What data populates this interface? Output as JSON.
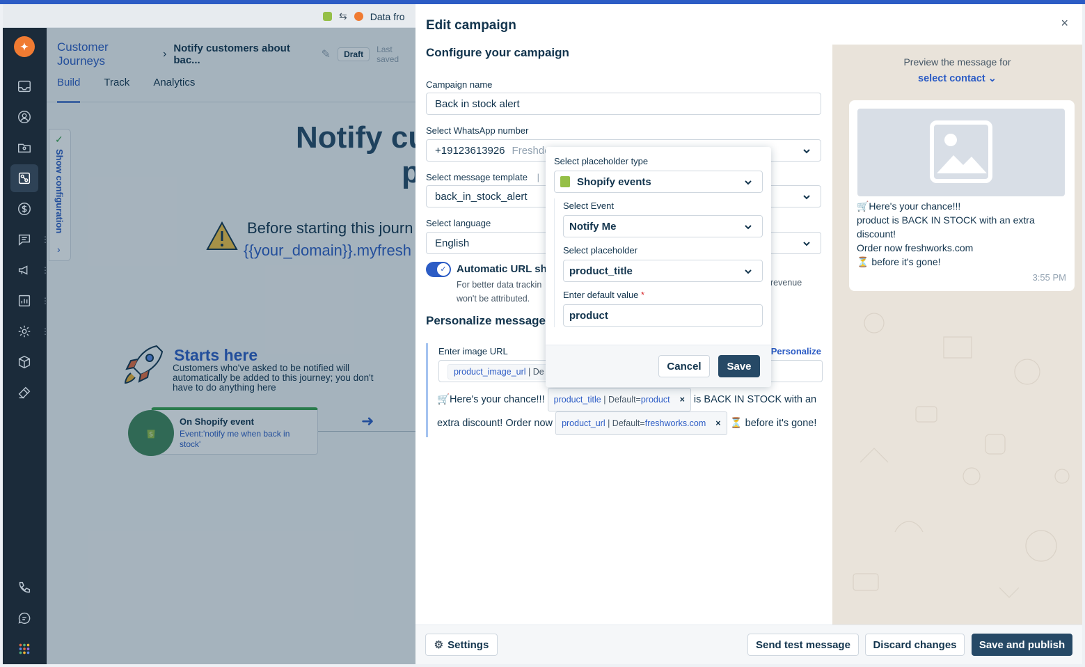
{
  "topbar": {
    "notice": "Data fro"
  },
  "app": {
    "breadcrumb_root": "Customer Journeys",
    "breadcrumb_current": "Notify customers about bac...",
    "status": "Draft",
    "last_saved": "Last saved",
    "tabs": [
      "Build",
      "Track",
      "Analytics"
    ],
    "show_configuration": "Show configuration",
    "big_title_line1": "Notify cu",
    "big_title_line2": "p",
    "warning_text": "Before starting this journ",
    "warning_domain": "{{your_domain}}.myfresh",
    "starts_here": "Starts here",
    "starts_desc": "Customers who've asked to be notified will automatically be added to this journey; you don't have to do anything here",
    "event_title": "On Shopify event",
    "event_desc": "Event:'notify me when back in stock'"
  },
  "drawer": {
    "title": "Edit campaign",
    "close": "×",
    "configure_title": "Configure your campaign",
    "campaign_name_label": "Campaign name",
    "campaign_name_value": "Back in stock alert",
    "whatsapp_label": "Select WhatsApp number",
    "whatsapp_value": "+19123613926",
    "whatsapp_muted": "Freshde",
    "template_label": "Select message template",
    "template_sep": "|",
    "template_value": "back_in_stock_alert",
    "language_label": "Select language",
    "language_value": "English",
    "auto_url_label": "Automatic URL sho",
    "auto_url_help": "For better data trackin won't be attributed.",
    "auto_url_help_tail": "revenue",
    "personalize_title": "Personalize message",
    "image_url_label": "Enter image URL",
    "personalize_link": "Personalize",
    "image_chip_key": "product_image_url",
    "image_chip_rest": "| De",
    "msg_prefix": "🛒Here's your chance!!!",
    "chip1_key": "product_title",
    "chip1_mid": " | Default=",
    "chip1_val": "product",
    "msg_mid": "is BACK IN STOCK with an extra discount! Order now",
    "chip2_key": "product_url",
    "chip2_mid": " | Default=",
    "chip2_val": "freshworks.com",
    "msg_suffix": "⏳ before it's gone!",
    "chip_close": "×"
  },
  "preview": {
    "header": "Preview the message for",
    "select_contact": "select contact ⌄",
    "lines": [
      "🛒Here's your chance!!!",
      "product is BACK IN STOCK with an extra discount!",
      "Order now freshworks.com",
      "⏳ before it's gone!"
    ],
    "time": "3:55 PM"
  },
  "footer": {
    "settings": "Settings",
    "send_test": "Send test message",
    "discard": "Discard changes",
    "save_publish": "Save and publish"
  },
  "popover": {
    "type_label": "Select placeholder type",
    "type_value": "Shopify events",
    "event_label": "Select Event",
    "event_value": "Notify Me",
    "placeholder_label": "Select placeholder",
    "placeholder_value": "product_title",
    "default_label": "Enter default value",
    "required_mark": "*",
    "default_value": "product",
    "cancel": "Cancel",
    "save": "Save"
  },
  "colors": {
    "brand": "#2c5cc5",
    "primary_button": "#264966",
    "nav": "#1b2b3a",
    "shopify_green": "#41865a"
  },
  "icons": [
    "logo",
    "inbox-icon",
    "contact-icon",
    "folder-icon",
    "journey-icon",
    "dollar-icon",
    "chat-icon",
    "megaphone-icon",
    "chart-icon",
    "gear-icon",
    "box-icon",
    "tool-icon",
    "phone-icon",
    "chat-bubble-icon",
    "apps-grid-icon"
  ]
}
